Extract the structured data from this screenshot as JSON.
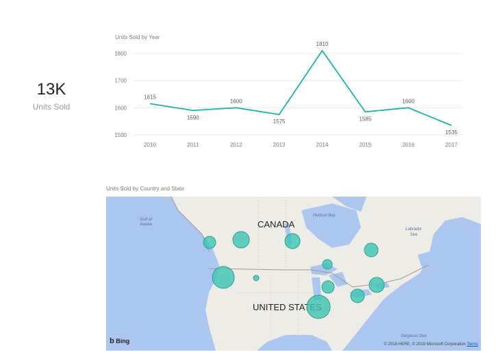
{
  "card": {
    "value": "13K",
    "label": "Units Sold"
  },
  "line_visual": {
    "title": "Units Sold by Year"
  },
  "map_visual": {
    "title": "Units Sold by Country and State",
    "labels": {
      "canada": "CANADA",
      "united_states": "UNITED STATES",
      "gulf_of_alaska": "Gulf of Alaska",
      "hudson_bay": "Hudson Bay",
      "labrador_sea": "Labrador Sea",
      "sargasso_sea": "Sargasso Sea"
    },
    "bubble_color": "#3cc4b4",
    "bing_label": "Bing",
    "copyright": "© 2018 HERE, © 2018 Microsoft Corporation",
    "terms_label": "Terms"
  },
  "chart_data": {
    "type": "line",
    "title": "Units Sold by Year",
    "x": [
      "2010",
      "2011",
      "2012",
      "2013",
      "2014",
      "2015",
      "2016",
      "2017"
    ],
    "series": [
      {
        "values": [
          1615,
          1590,
          1600,
          1575,
          1810,
          1585,
          1600,
          1535
        ]
      }
    ],
    "data_labels": [
      "1615",
      "1590",
      "1600",
      "1575",
      "1810",
      "1585",
      "1600",
      "1535"
    ],
    "yticks": [
      "1500",
      "1600",
      "1700",
      "1800"
    ],
    "ylim": [
      1500,
      1820
    ],
    "grid": true,
    "line_color": "#1ab5a9"
  }
}
